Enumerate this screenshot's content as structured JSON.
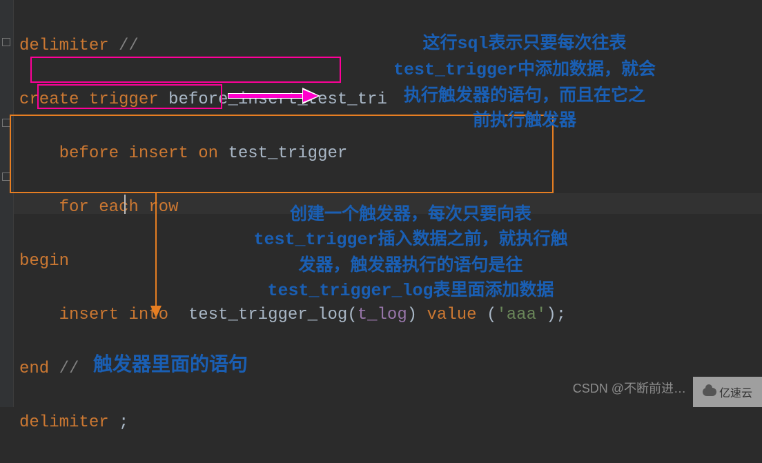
{
  "code": {
    "line1": {
      "kw": "delimiter",
      "comment": " //"
    },
    "line2": {
      "kw": "create trigger",
      "name": " before_insert_test_tri"
    },
    "line3": {
      "indent": "    ",
      "kw": "before insert on",
      "name": " test_trigger"
    },
    "line4": {
      "indent": "    ",
      "kw": "for each row"
    },
    "line5": {
      "kw": "begin"
    },
    "line6": {
      "indent": "    ",
      "kw1": "insert into",
      "name1": "  test_trigger_log(",
      "ident": "t_log",
      "name2": ")",
      "kw2": " value ",
      "txt1": "(",
      "str": "'aaa'",
      "txt2": ");"
    },
    "line7": {
      "kw": "end",
      "comment": " //"
    },
    "line8": {
      "kw": "delimiter",
      "txt": " ;"
    }
  },
  "anno1": {
    "l1a": "这行",
    "l1b": "sql",
    "l1c": "表示只要每次往表",
    "l2a": "test_trigger",
    "l2b": "中添加数据，就会",
    "l3": "执行触发器的语句，而且在它之",
    "l4": "前执行触发器"
  },
  "anno2": {
    "l1": "创建一个触发器，每次只要向表",
    "l2a": "test_trigger",
    "l2b": "插入数据之前，就执行触",
    "l3": "发器，触发器执行的语句是往",
    "l4a": "test_trigger_log",
    "l4b": "表里面添加数据"
  },
  "anno3": "触发器里面的语句",
  "watermark1": "CSDN @不断前进…",
  "watermark2": "亿速云"
}
